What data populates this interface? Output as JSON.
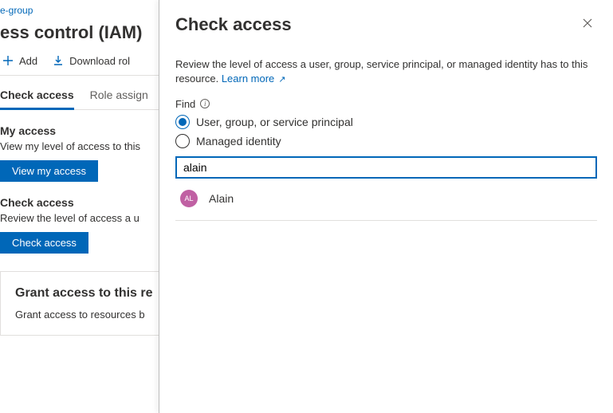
{
  "breadcrumb": {
    "link": "e-group"
  },
  "page": {
    "title": "ess control (IAM)"
  },
  "toolbar": {
    "add_label": "Add",
    "download_label": "Download rol"
  },
  "tabs": {
    "check_access": "Check access",
    "role_assignments": "Role assign"
  },
  "my_access": {
    "heading": "My access",
    "desc": "View my level of access to this",
    "button": "View my access"
  },
  "check_access": {
    "heading": "Check access",
    "desc": "Review the level of access a u",
    "button": "Check access"
  },
  "grant": {
    "heading": "Grant access to this re",
    "desc": "Grant access to resources b"
  },
  "panel": {
    "title": "Check access",
    "description": "Review the level of access a user, group, service principal, or managed identity has to this resource. ",
    "learn_more": "Learn more",
    "find_label": "Find",
    "radio_user": "User, group, or service principal",
    "radio_managed": "Managed identity",
    "input_value": "alain",
    "result": {
      "initials": "AL",
      "name": "Alain"
    }
  }
}
